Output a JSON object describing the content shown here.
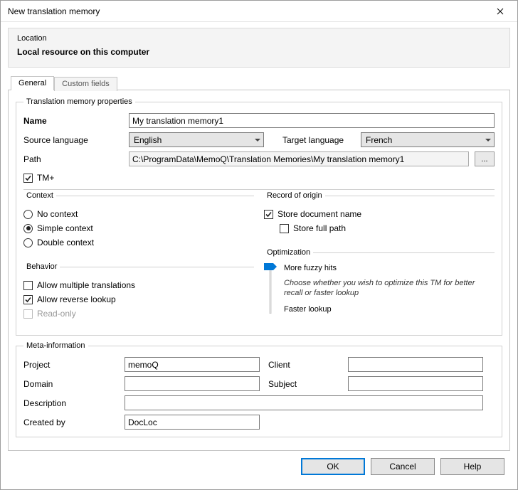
{
  "window": {
    "title": "New translation memory"
  },
  "location": {
    "heading": "Location",
    "text": "Local resource on this computer"
  },
  "tabs": {
    "general": "General",
    "custom": "Custom fields"
  },
  "props": {
    "legend": "Translation memory properties",
    "name_label": "Name",
    "name_value": "My translation memory1",
    "src_label": "Source language",
    "src_value": "English",
    "tgt_label": "Target language",
    "tgt_value": "French",
    "path_label": "Path",
    "path_value": "C:\\ProgramData\\MemoQ\\Translation Memories\\My translation memory1",
    "browse": "...",
    "tmplus_label": "TM+"
  },
  "context": {
    "legend": "Context",
    "none": "No context",
    "simple": "Simple context",
    "double": "Double context"
  },
  "behavior": {
    "legend": "Behavior",
    "multi": "Allow multiple translations",
    "reverse": "Allow reverse lookup",
    "readonly": "Read-only"
  },
  "record": {
    "legend": "Record of origin",
    "store_doc": "Store document name",
    "store_full": "Store full path"
  },
  "optim": {
    "legend": "Optimization",
    "more": "More fuzzy hits",
    "mid": "Choose whether you wish to optimize this TM for better recall or faster lookup",
    "fast": "Faster lookup"
  },
  "meta": {
    "legend": "Meta-information",
    "project_label": "Project",
    "project_value": "memoQ",
    "client_label": "Client",
    "client_value": "",
    "domain_label": "Domain",
    "domain_value": "",
    "subject_label": "Subject",
    "subject_value": "",
    "desc_label": "Description",
    "desc_value": "",
    "created_label": "Created by",
    "created_value": "DocLoc"
  },
  "buttons": {
    "ok": "OK",
    "cancel": "Cancel",
    "help": "Help"
  }
}
